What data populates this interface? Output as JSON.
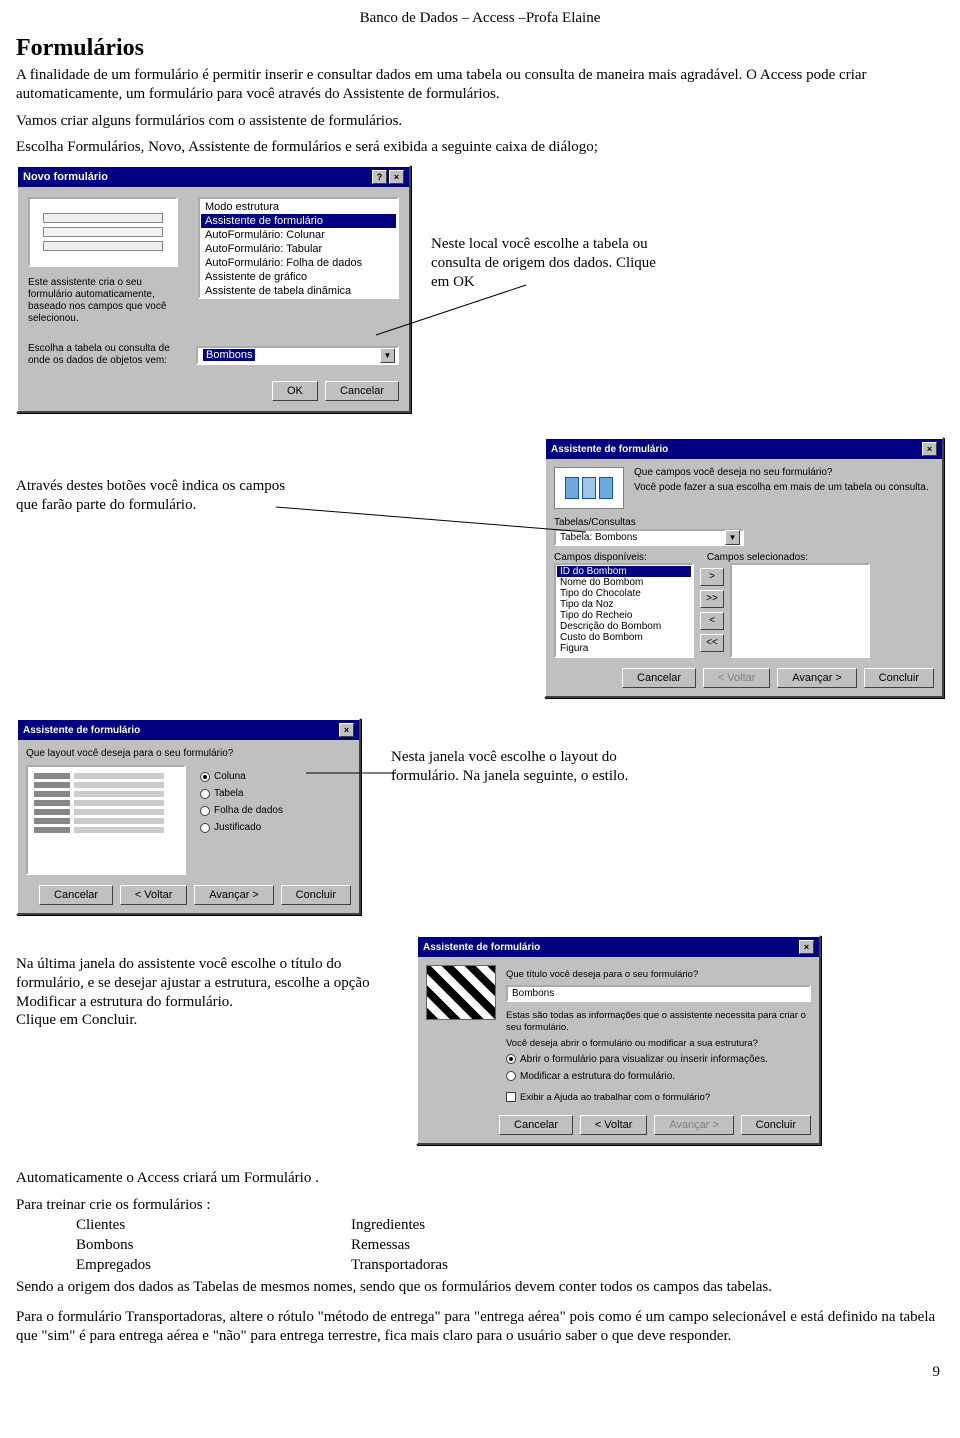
{
  "header": "Banco de Dados – Access –Profa Elaine",
  "title": "Formulários",
  "intro": {
    "p1": "A finalidade de um formulário é permitir inserir e consultar dados em uma tabela ou consulta de maneira mais agradável. O Access pode criar automaticamente, um formulário para você através do Assistente de formulários.",
    "p2": "Vamos criar alguns formulários com o assistente de formulários.",
    "p3": "Escolha Formulários, Novo, Assistente de formulários e será exibida a seguinte caixa de diálogo;"
  },
  "dialog1": {
    "title": "Novo formulário",
    "left_text": "Este assistente cria o seu formulário automaticamente, baseado nos campos que você selecionou.",
    "list": {
      "items": [
        "Modo estrutura",
        "Assistente de formulário",
        "AutoFormulário: Colunar",
        "AutoFormulário: Tabular",
        "AutoFormulário: Folha de dados",
        "Assistente de gráfico",
        "Assistente de tabela dinâmica"
      ],
      "selected_index": 1
    },
    "lower_label": "Escolha a tabela ou consulta de onde os dados de objetos vem:",
    "combo_value": "Bombons",
    "ok": "OK",
    "cancel": "Cancelar",
    "callout": "Neste local você escolhe a tabela ou consulta de origem dos dados. Clique em OK"
  },
  "row2_note": "Através destes botões você indica os campos que farão parte do formulário.",
  "dialog2": {
    "title": "Assistente de formulário",
    "prompt": "Que campos você deseja no seu formulário?",
    "prompt2": "Você pode fazer a sua escolha em mais de um tabela ou consulta.",
    "tc_label": "Tabelas/Consultas",
    "tc_value": "Tabela: Bombons",
    "avail_label": "Campos disponíveis:",
    "sel_label": "Campos selecionados:",
    "avail": [
      "ID do Bombom",
      "Nome do Bombom",
      "Tipo do Chocolate",
      "Tipo da Noz",
      "Tipo do Recheio",
      "Descrição do Bombom",
      "Custo do Bombom",
      "Figura"
    ],
    "avail_selected_index": 0,
    "arrows": [
      ">",
      ">>",
      "<",
      "<<"
    ],
    "btn_cancel": "Cancelar",
    "btn_back": "< Voltar",
    "btn_next": "Avançar >",
    "btn_finish": "Concluir"
  },
  "row3_note": "Nesta janela você escolhe o layout do formulário. Na janela seguinte, o estilo.",
  "dialog3": {
    "title": "Assistente de formulário",
    "question": "Que layout você deseja para o seu formulário?",
    "options": [
      "Coluna",
      "Tabela",
      "Folha de dados",
      "Justificado"
    ],
    "selected_index": 0,
    "btn_cancel": "Cancelar",
    "btn_back": "< Voltar",
    "btn_next": "Avançar >",
    "btn_finish": "Concluir"
  },
  "row4_note": "Na última janela do assistente você escolhe o título do formulário, e se desejar ajustar a estrutura, escolhe a opção Modificar a estrutura do formulário.\nClique em Concluir.",
  "dialog4": {
    "title": "Assistente de formulário",
    "q": "Que título você deseja para o seu formulário?",
    "input": "Bombons",
    "txt1": "Estas são todas as informações que o assistente necessita para criar o seu formulário.",
    "txt2": "Você deseja abrir o formulário ou modificar a sua estrutura?",
    "opt1": "Abrir o formulário para visualizar ou inserir informações.",
    "opt2": "Modificar a estrutura do formulário.",
    "chk": "Exibir a Ajuda ao trabalhar com o formulário?",
    "opt_selected": 0,
    "btn_cancel": "Cancelar",
    "btn_back": "< Voltar",
    "btn_next": "Avançar >",
    "btn_finish": "Concluir"
  },
  "after": {
    "p1": "Automaticamente o Access criará um Formulário .",
    "p2": "Para treinar crie os formulários :",
    "col1": [
      "Clientes",
      "Bombons",
      "Empregados"
    ],
    "col2": [
      "Ingredientes",
      "Remessas",
      "Transportadoras"
    ],
    "p3": "Sendo a origem dos dados as Tabelas de mesmos nomes, sendo que os formulários devem conter todos os campos das tabelas.",
    "p4": "Para o formulário Transportadoras, altere o rótulo \"método de entrega\" para \"entrega aérea\" pois como é um campo selecionável e está definido na tabela que \"sim\" é para entrega aérea e \"não\" para entrega terrestre, fica mais claro para o usuário saber o que deve responder."
  },
  "page_number": "9"
}
